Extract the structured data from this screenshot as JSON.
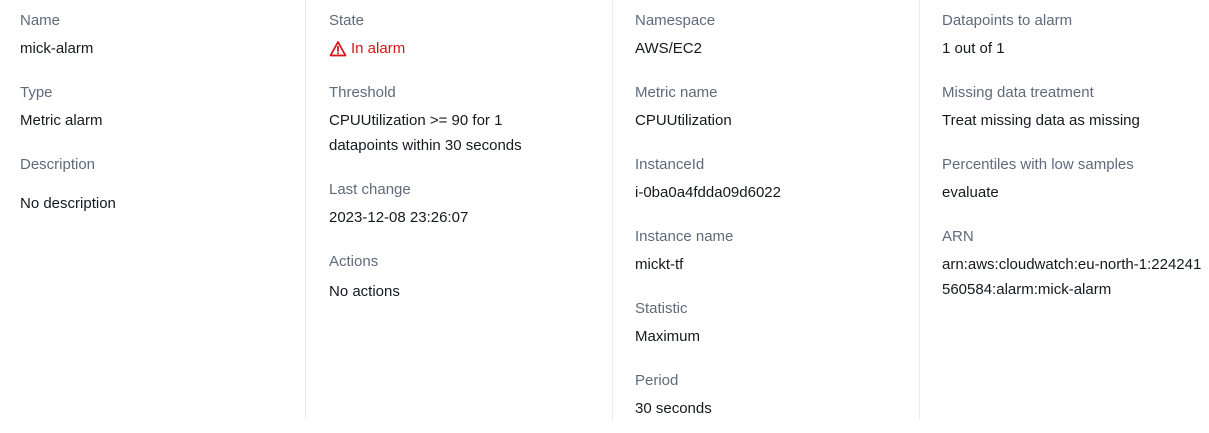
{
  "columns": {
    "general": {
      "name": {
        "label": "Name",
        "value": "mick-alarm"
      },
      "type": {
        "label": "Type",
        "value": "Metric alarm"
      },
      "description": {
        "label": "Description",
        "value": "No description"
      }
    },
    "status": {
      "state": {
        "label": "State",
        "value": "In alarm",
        "icon": "warning-icon",
        "color": "#d91515"
      },
      "threshold": {
        "label": "Threshold",
        "value": "CPUUtilization >= 90 for 1 datapoints within 30 seconds"
      },
      "last_change": {
        "label": "Last change",
        "value": "2023-12-08 23:26:07"
      },
      "actions": {
        "label": "Actions",
        "value": "No actions"
      }
    },
    "metric": {
      "namespace": {
        "label": "Namespace",
        "value": "AWS/EC2"
      },
      "metric_name": {
        "label": "Metric name",
        "value": "CPUUtilization"
      },
      "instance_id": {
        "label": "InstanceId",
        "value": "i-0ba0a4fdda09d6022"
      },
      "instance_name": {
        "label": "Instance name",
        "value": "mickt-tf"
      },
      "statistic": {
        "label": "Statistic",
        "value": "Maximum"
      },
      "period": {
        "label": "Period",
        "value": "30 seconds"
      }
    },
    "evaluation": {
      "datapoints": {
        "label": "Datapoints to alarm",
        "value": "1 out of 1"
      },
      "missing_data": {
        "label": "Missing data treatment",
        "value": "Treat missing data as missing"
      },
      "percentiles": {
        "label": "Percentiles with low samples",
        "value": "evaluate"
      },
      "arn": {
        "label": "ARN",
        "value": "arn:aws:cloudwatch:eu-north-1:224241560584:alarm:mick-alarm"
      }
    }
  },
  "colors": {
    "label": "#5f6b7a",
    "value": "#16191f",
    "alarm": "#d91515",
    "divider": "#e9ebed"
  }
}
